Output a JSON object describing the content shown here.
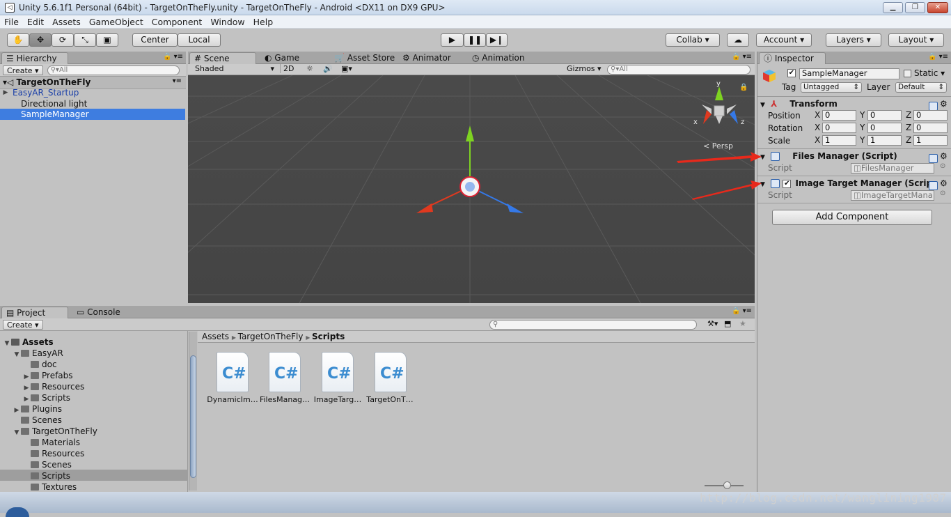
{
  "window": {
    "title": "Unity 5.6.1f1 Personal (64bit) - TargetOnTheFly.unity - TargetOnTheFly - Android <DX11 on DX9 GPU>"
  },
  "menu": [
    "File",
    "Edit",
    "Assets",
    "GameObject",
    "Component",
    "Window",
    "Help"
  ],
  "toolbar": {
    "center": "Center",
    "local": "Local",
    "collab": "Collab",
    "account": "Account",
    "layers": "Layers",
    "layout": "Layout"
  },
  "hierarchy": {
    "tab": "Hierarchy",
    "create": "Create",
    "search_placeholder": "All",
    "scene": "TargetOnTheFly",
    "items": [
      "EasyAR_Startup",
      "Directional light",
      "SampleManager"
    ]
  },
  "scene": {
    "tabs": [
      "Scene",
      "Game",
      "Asset Store",
      "Animator",
      "Animation"
    ],
    "shading": "Shaded",
    "mode2d": "2D",
    "gizmos": "Gizmos",
    "search_placeholder": "All",
    "persp": "Persp",
    "axes": {
      "x": "x",
      "y": "y",
      "z": "z"
    }
  },
  "inspector": {
    "tab": "Inspector",
    "object_name": "SampleManager",
    "static_label": "Static",
    "tag_label": "Tag",
    "tag_value": "Untagged",
    "layer_label": "Layer",
    "layer_value": "Default",
    "transform": {
      "title": "Transform",
      "position": {
        "label": "Position",
        "x": "0",
        "y": "0",
        "z": "0"
      },
      "rotation": {
        "label": "Rotation",
        "x": "0",
        "y": "0",
        "z": "0"
      },
      "scale": {
        "label": "Scale",
        "x": "1",
        "y": "1",
        "z": "1"
      }
    },
    "components": [
      {
        "title": "Files Manager (Script)",
        "script_label": "Script",
        "script_value": "FilesManager"
      },
      {
        "title": "Image Target Manager (Scrip",
        "script_label": "Script",
        "script_value": "ImageTargetMana"
      }
    ],
    "add_component": "Add Component",
    "axis_labels": {
      "x": "X",
      "y": "Y",
      "z": "Z"
    }
  },
  "project": {
    "tabs": [
      "Project",
      "Console"
    ],
    "create": "Create",
    "breadcrumb": [
      "Assets",
      "TargetOnTheFly",
      "Scripts"
    ],
    "tree": [
      {
        "label": "Assets",
        "depth": 0,
        "expanded": true,
        "bold": true
      },
      {
        "label": "EasyAR",
        "depth": 1,
        "expanded": true
      },
      {
        "label": "doc",
        "depth": 2
      },
      {
        "label": "Prefabs",
        "depth": 2,
        "collapsed": true
      },
      {
        "label": "Resources",
        "depth": 2,
        "collapsed": true
      },
      {
        "label": "Scripts",
        "depth": 2,
        "collapsed": true
      },
      {
        "label": "Plugins",
        "depth": 1,
        "collapsed": true
      },
      {
        "label": "Scenes",
        "depth": 1
      },
      {
        "label": "TargetOnTheFly",
        "depth": 1,
        "expanded": true
      },
      {
        "label": "Materials",
        "depth": 2
      },
      {
        "label": "Resources",
        "depth": 2
      },
      {
        "label": "Scenes",
        "depth": 2
      },
      {
        "label": "Scripts",
        "depth": 2,
        "selected": true
      },
      {
        "label": "Textures",
        "depth": 2
      }
    ],
    "files": [
      "DynamicIm…",
      "FilesManag…",
      "ImageTarg…",
      "TargetOnT…"
    ]
  },
  "watermark": "http://blog.csdn.net/wanglining1987",
  "colors": {
    "scene_bg": "#474747",
    "selection": "#3e7de0",
    "arrow": "#e8291b",
    "x_axis": "#e0391f",
    "y_axis": "#7ed321",
    "z_axis": "#3579e8"
  }
}
